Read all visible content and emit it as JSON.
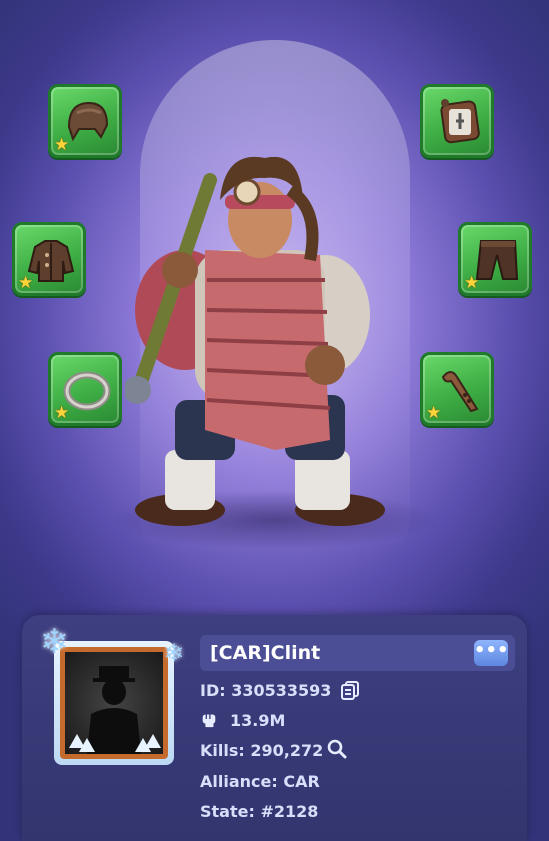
{
  "equipment": {
    "left": [
      {
        "icon": "leather-aviator-cap-icon",
        "stars": "★"
      },
      {
        "icon": "leather-jacket-icon",
        "stars": "★"
      },
      {
        "icon": "silver-ring-icon",
        "stars": "★"
      }
    ],
    "right": [
      {
        "icon": "compass-badge-icon",
        "stars": ""
      },
      {
        "icon": "leather-pants-icon",
        "stars": "★"
      },
      {
        "icon": "wooden-flute-icon",
        "stars": "★"
      }
    ]
  },
  "player": {
    "name": "[CAR]Clint",
    "more_label": "•••",
    "id_text": "ID: 330533593",
    "power": "13.9M",
    "kills_text": "Kills: 290,272",
    "alliance_text": "Alliance: CAR",
    "state_text": "State: #2128"
  },
  "colors": {
    "slot_green": "#3eae45",
    "panel_bg": "#3d3f80",
    "name_bar": "#4b4e95",
    "more_button": "#6f95ea",
    "star": "#ffd43b"
  }
}
